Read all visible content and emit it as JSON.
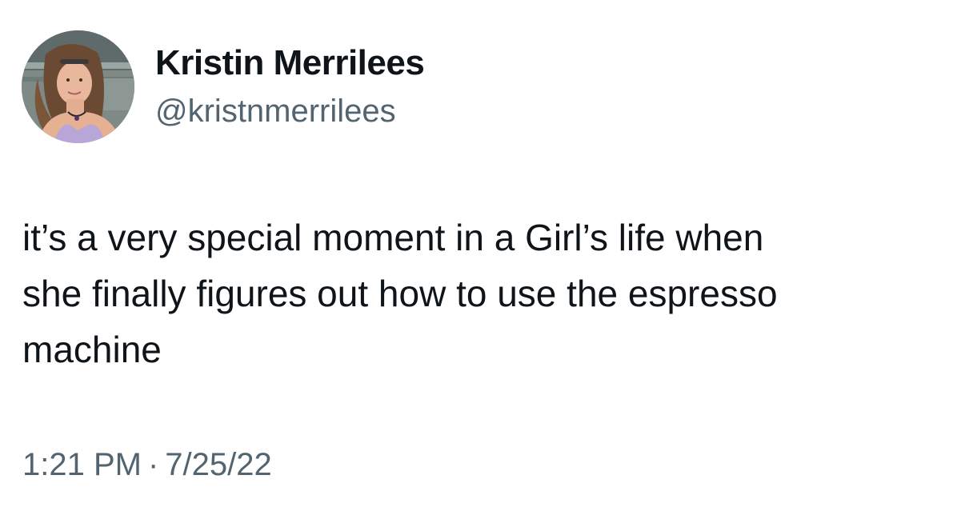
{
  "author": {
    "display_name": "Kristin Merrilees",
    "handle": "@kristnmerrilees",
    "avatar_icon": "profile-photo"
  },
  "tweet": {
    "text_lines": [
      "it’s a very special moment in a Girl’s life when",
      "she finally figures out how to use the espresso",
      "machine"
    ],
    "time": "1:21 PM",
    "separator": "·",
    "date": "7/25/22"
  },
  "colors": {
    "text_primary": "#0f1419",
    "text_secondary": "#536471",
    "background": "#ffffff"
  }
}
